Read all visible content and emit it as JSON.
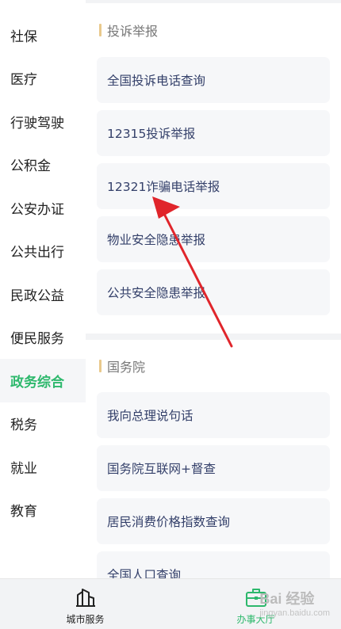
{
  "sidebar": {
    "items": [
      {
        "label": "社保"
      },
      {
        "label": "医疗"
      },
      {
        "label": "行驶驾驶"
      },
      {
        "label": "公积金"
      },
      {
        "label": "公安办证"
      },
      {
        "label": "公共出行"
      },
      {
        "label": "民政公益"
      },
      {
        "label": "便民服务"
      },
      {
        "label": "政务综合",
        "active": true
      },
      {
        "label": "税务"
      },
      {
        "label": "就业"
      },
      {
        "label": "教育"
      }
    ]
  },
  "sections": [
    {
      "title": "投诉举报",
      "cards": [
        "全国投诉电话查询",
        "12315投诉举报",
        "12321诈骗电话举报",
        "物业安全隐患举报",
        "公共安全隐患举报"
      ]
    },
    {
      "title": "国务院",
      "cards": [
        "我向总理说句话",
        "国务院互联网+督查",
        "居民消费价格指数查询",
        "全国人口查询"
      ]
    }
  ],
  "tabbar": {
    "tabs": [
      {
        "label": "城市服务",
        "icon": "city-buildings-icon"
      },
      {
        "label": "办事大厅",
        "icon": "briefcase-icon",
        "active": true
      }
    ]
  },
  "colors": {
    "accent": "#2db86c",
    "arrow": "#e0252b",
    "section_bar": "#e9c98c"
  },
  "watermark": {
    "text": "Bai 经验",
    "sub": "jingyan.baidu.com"
  }
}
